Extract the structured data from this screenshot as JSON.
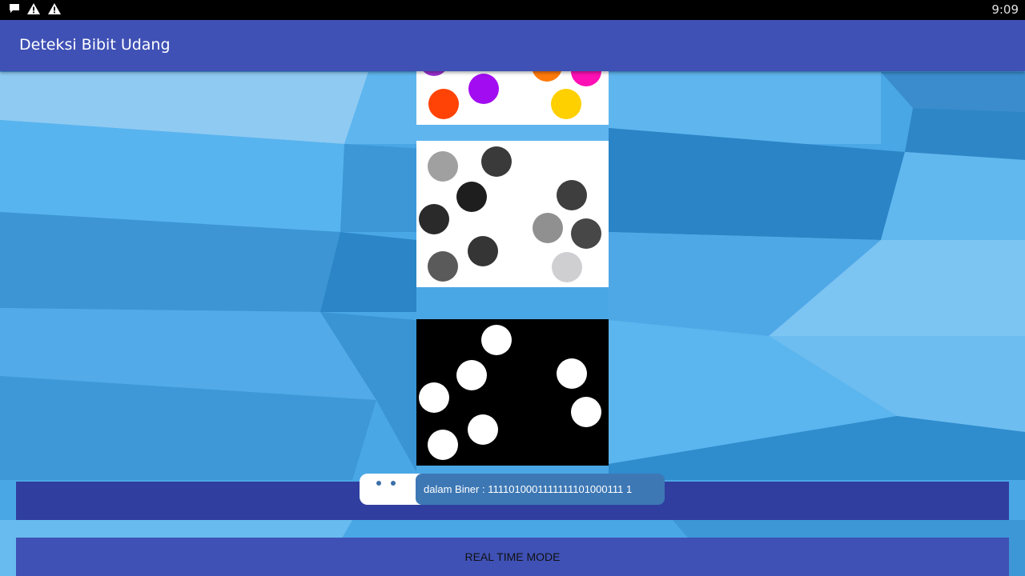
{
  "status_bar": {
    "time": "9:09",
    "icons": [
      "notification-message-icon",
      "warning-icon",
      "warning-icon"
    ]
  },
  "app_bar": {
    "title": "Deteksi Bibit Udang"
  },
  "images": {
    "color": {
      "description_icon": "colored-dots-image"
    },
    "grayscale": {
      "description_icon": "grayscale-dots-image"
    },
    "binary": {
      "description_icon": "binary-dots-image"
    }
  },
  "result": {
    "toast_text": "dalam Biner : 1111010001111111101000111 1"
  },
  "buttons": {
    "real_time_label": "REAL TIME MODE"
  },
  "colors": {
    "app_bar": "#3f51b5",
    "result_bar": "#303f9f",
    "button": "#3f51b5",
    "toast": "#3d78b5"
  }
}
